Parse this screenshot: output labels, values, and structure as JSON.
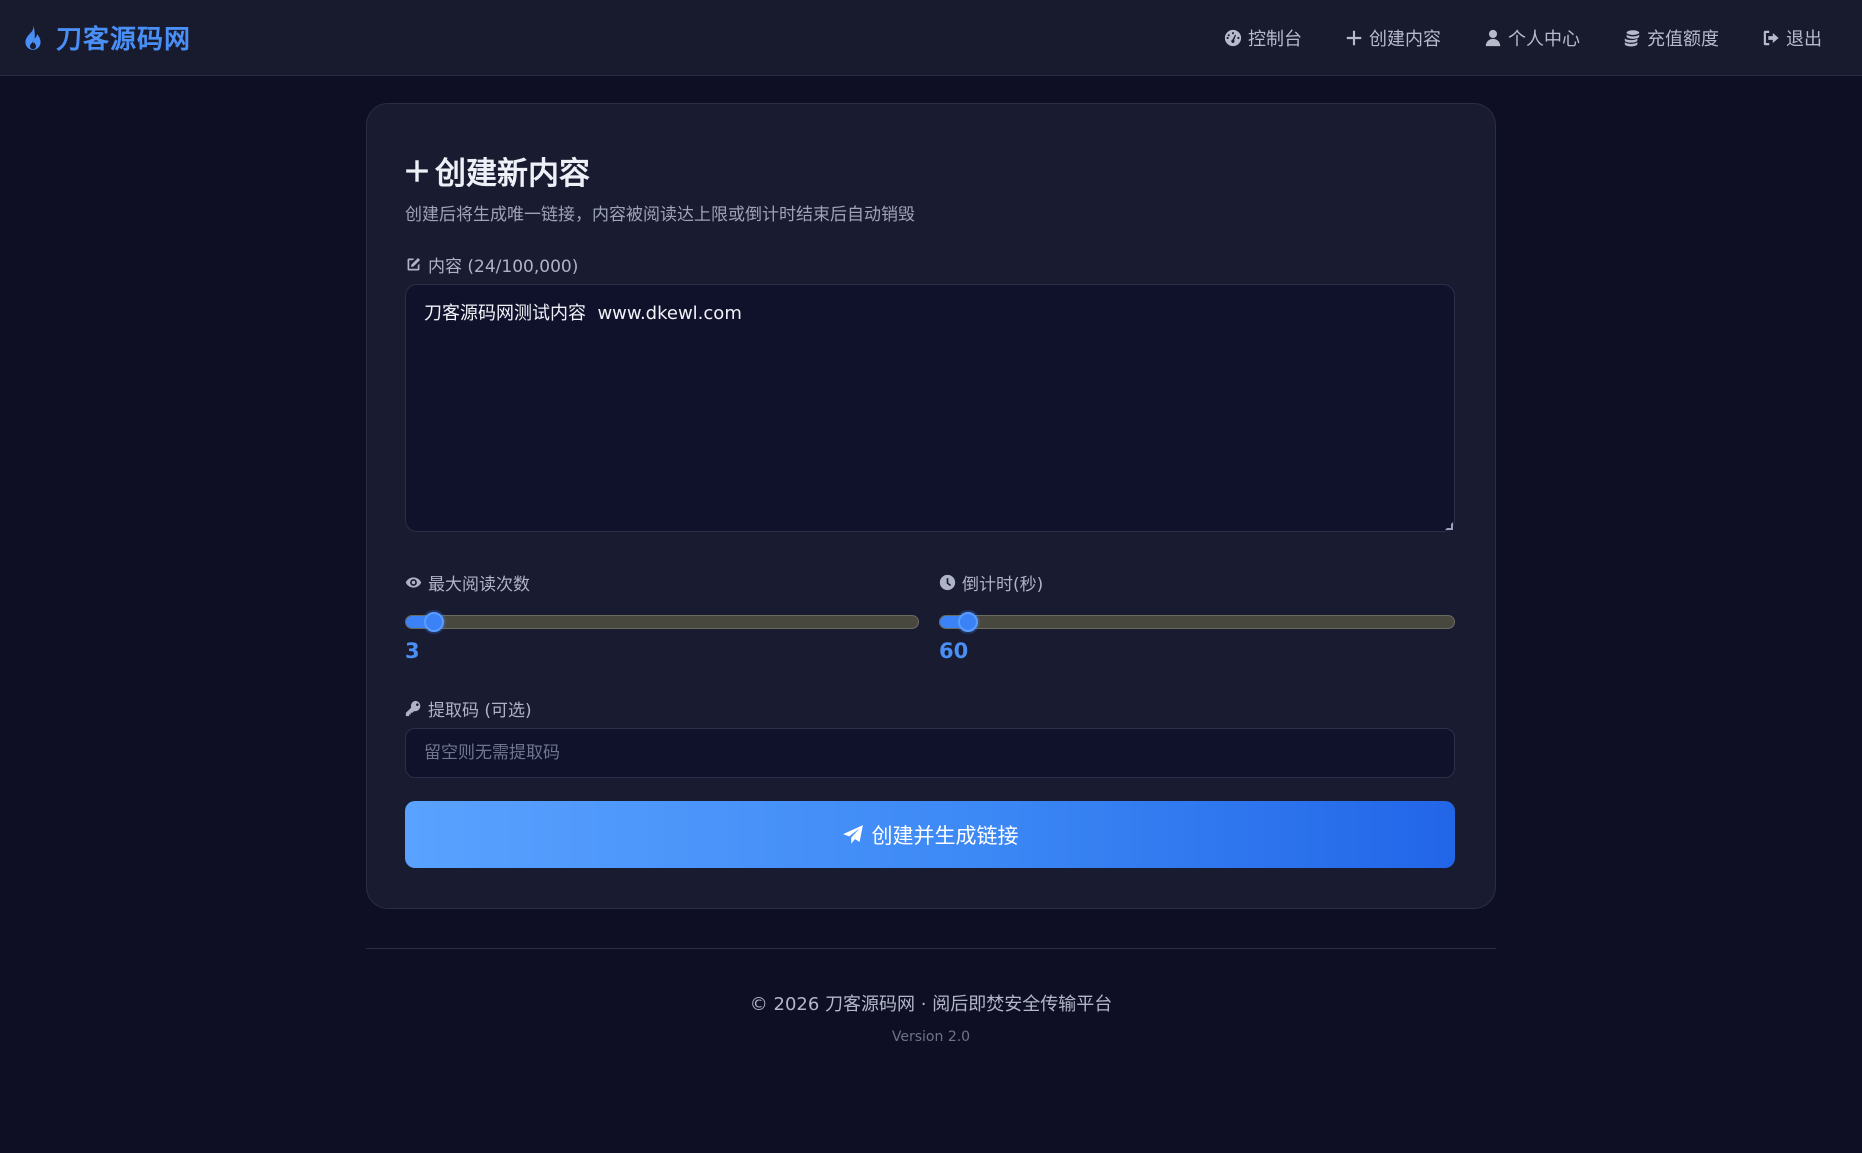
{
  "brand": {
    "name": "刀客源码网",
    "icon": "flame-icon"
  },
  "nav": {
    "items": [
      {
        "label": "控制台",
        "icon": "dashboard-icon"
      },
      {
        "label": "创建内容",
        "icon": "plus-icon"
      },
      {
        "label": "个人中心",
        "icon": "user-icon"
      },
      {
        "label": "充值额度",
        "icon": "coins-icon"
      },
      {
        "label": "退出",
        "icon": "logout-icon"
      }
    ]
  },
  "form": {
    "title": "创建新内容",
    "subtitle": "创建后将生成唯一链接，内容被阅读达上限或倒计时结束后自动销毁",
    "content_label": "内容 (24/100,000)",
    "content_value": "刀客源码网测试内容  www.dkewl.com",
    "max_reads_label": "最大阅读次数",
    "max_reads_value": "3",
    "max_reads_fraction": 0.02,
    "countdown_label": "倒计时(秒)",
    "countdown_value": "60",
    "countdown_fraction": 0.02,
    "code_label": "提取码 (可选)",
    "code_placeholder": "留空则无需提取码",
    "code_value": "",
    "submit_label": "创建并生成链接"
  },
  "footer": {
    "copyright": "© 2026 刀客源码网 · 阅后即焚安全传输平台",
    "version": "Version 2.0"
  },
  "colors": {
    "accent": "#3b82f6",
    "brand": "#4a8ff5",
    "background": "#0e0f24",
    "card": "#191b30"
  }
}
